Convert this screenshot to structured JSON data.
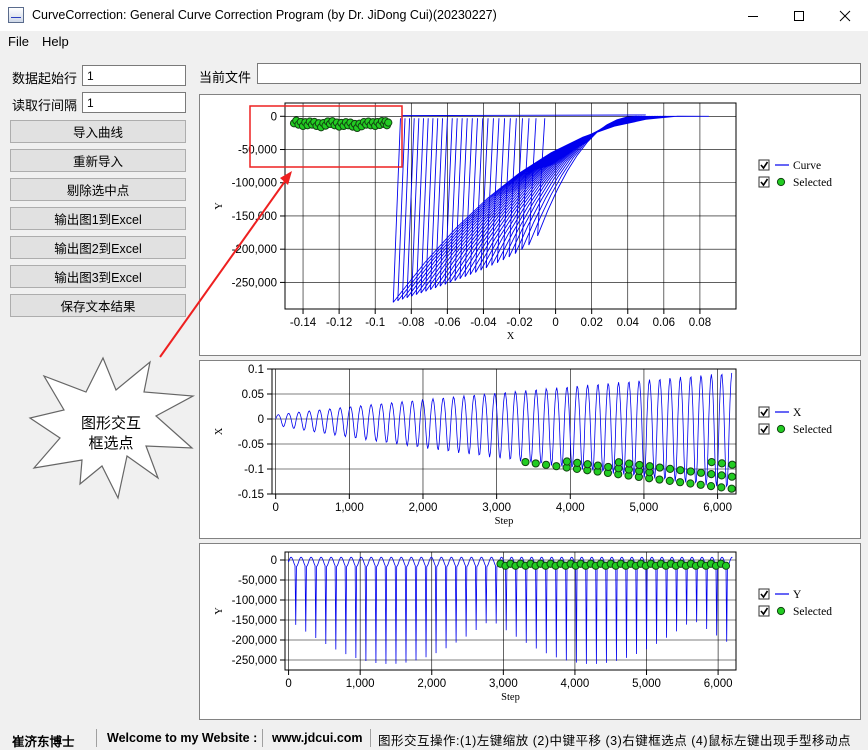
{
  "window": {
    "title": "CurveCorrection: General Curve Correction Program (by Dr. JiDong Cui)(20230227)",
    "min_glyph": "—",
    "max_glyph": "☐",
    "close_glyph": "✕"
  },
  "menu": {
    "file": "File",
    "help": "Help"
  },
  "inputs": {
    "start_row_label": "数据起始行",
    "start_row_value": "1",
    "row_interval_label": "读取行间隔",
    "row_interval_value": "1",
    "current_file_label": "当前文件",
    "current_file_value": ""
  },
  "buttons": {
    "import_curve": "导入曲线",
    "reimport": "重新导入",
    "remove_selected": "剔除选中点",
    "export_fig1": "输出图1到Excel",
    "export_fig2": "输出图2到Excel",
    "export_fig3": "输出图3到Excel",
    "save_text": "保存文本结果"
  },
  "callout": {
    "line1": "图形交互",
    "line2": "框选点"
  },
  "colors": {
    "curve": "#0000ee",
    "selected_fill": "#22cc22",
    "selected_edge": "#114411",
    "annotation": "#ee2020"
  },
  "status": {
    "author": "崔济东博士",
    "welcome": "Welcome to my Website :",
    "website": "www.jdcui.com",
    "hint": "图形交互操作:(1)左键缩放 (2)中键平移 (3)右键框选点 (4)鼠标左键出现手型移动点"
  },
  "chart_data": [
    {
      "type": "line",
      "title": "",
      "xlabel": "X",
      "ylabel": "Y",
      "xlim": [
        -0.15,
        0.1
      ],
      "ylim": [
        -290000,
        20000
      ],
      "xticks": [
        "-0.14",
        "-0.12",
        "-0.1",
        "-0.08",
        "-0.06",
        "-0.04",
        "-0.02",
        "0",
        "0.02",
        "0.04",
        "0.06",
        "0.08"
      ],
      "yticks": [
        "0",
        "-50,000",
        "-100,000",
        "-150,000",
        "-200,000",
        "-250,000"
      ],
      "series": [
        {
          "name": "Curve",
          "description": "hysteresis loops: near-vertical drops from y≈0 to y≈-280,000 between x≈-0.09 and x≈0, rising branch curving back to y≈0 at x≈0.09"
        },
        {
          "name": "Selected",
          "points": [
            [
              -0.145,
              -8000
            ],
            [
              -0.14,
              -12000
            ],
            [
              -0.135,
              -10000
            ],
            [
              -0.13,
              -14000
            ],
            [
              -0.125,
              -9000
            ],
            [
              -0.12,
              -13000
            ],
            [
              -0.115,
              -11000
            ],
            [
              -0.11,
              -15000
            ],
            [
              -0.105,
              -10000
            ],
            [
              -0.1,
              -12000
            ],
            [
              -0.095,
              -9000
            ],
            [
              -0.092,
              -13000
            ]
          ]
        }
      ],
      "legend": "right"
    },
    {
      "type": "line",
      "title": "",
      "xlabel": "Step",
      "ylabel": "X",
      "xlim": [
        -50,
        6250
      ],
      "ylim": [
        -0.15,
        0.1
      ],
      "xticks": [
        "0",
        "1,000",
        "2,000",
        "3,000",
        "4,000",
        "5,000",
        "6,000"
      ],
      "yticks": [
        "0.1",
        "0.05",
        "0",
        "-0.05",
        "-0.1",
        "-0.15"
      ],
      "series": [
        {
          "name": "X",
          "description": "oscillation with growing amplitude around 0, from ±0.01 at step 0 to about +0.09/-0.14 at step 6200"
        },
        {
          "name": "Selected",
          "description": "negative peaks between step ≈3000 and ≈6200, X from ≈-0.09 to ≈-0.145"
        }
      ],
      "legend": "right"
    },
    {
      "type": "line",
      "title": "",
      "xlabel": "Step",
      "ylabel": "Y",
      "xlim": [
        -50,
        6250
      ],
      "ylim": [
        -275000,
        20000
      ],
      "xticks": [
        "0",
        "1,000",
        "2,000",
        "3,000",
        "4,000",
        "5,000",
        "6,000"
      ],
      "yticks": [
        "0",
        "-50,000",
        "-100,000",
        "-150,000",
        "-200,000",
        "-250,000"
      ],
      "series": [
        {
          "name": "Y",
          "description": "repeated spikes from ≈0 down to ≈-150,000…-270,000 across steps 0–6200"
        },
        {
          "name": "Selected",
          "description": "points near Y≈-10,000 between step ≈2950 and ≈6150"
        }
      ],
      "legend": "right"
    }
  ]
}
